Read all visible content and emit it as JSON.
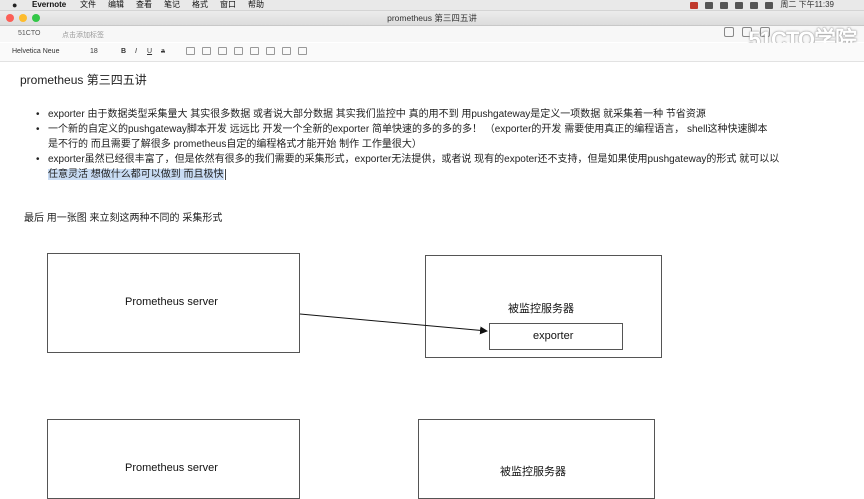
{
  "menubar": {
    "app_name": "Evernote",
    "items": [
      "文件",
      "编辑",
      "查看",
      "笔记",
      "格式",
      "窗口",
      "帮助"
    ],
    "clock": "周二 下午11:39"
  },
  "window": {
    "title": "prometheus 第三四五讲"
  },
  "notebar": {
    "notebook": "51CTO",
    "tag_placeholder": "点击添加标签"
  },
  "toolbar": {
    "font": "Helvetica Neue",
    "size": "18",
    "bold": "B",
    "italic": "I",
    "underline": "U",
    "strike": "a"
  },
  "watermark": {
    "text": "51CTO学院"
  },
  "note": {
    "title": "prometheus 第三四五讲",
    "bullets": [
      {
        "lines": [
          "exporter 由于数据类型采集量大 其实很多数据 或者说大部分数据 其实我们监控中 真的用不到  用pushgateway是定义一项数据 就采集着一种 节省资源"
        ]
      },
      {
        "lines": [
          "一个新的自定义的pushgateway脚本开发 远远比 开发一个全新的exporter 简单快速的多的多的多！  （exporter的开发 需要使用真正的编程语言，  shell这种快速脚本",
          "是不行的 而且需要了解很多 prometheus自定的编程格式才能开始 制作 工作量很大）"
        ]
      },
      {
        "line1": "exporter虽然已经很丰富了，但是依然有很多的我们需要的采集形式，exporter无法提供，或者说 现有的expoter还不支持，但是如果使用pushgateway的形式 就可以以",
        "line2_highlighted": "任意灵活 想做什么都可以做到 而且极快"
      }
    ],
    "paragraph": "最后 用一张图 来立刻这两种不同的 采集形式"
  },
  "diagram": {
    "top_server_label": "Prometheus server",
    "top_target_label": "被监控服务器",
    "top_exporter_label": "exporter",
    "bottom_server_label": "Prometheus server",
    "bottom_target_label": "被监控服务器"
  }
}
